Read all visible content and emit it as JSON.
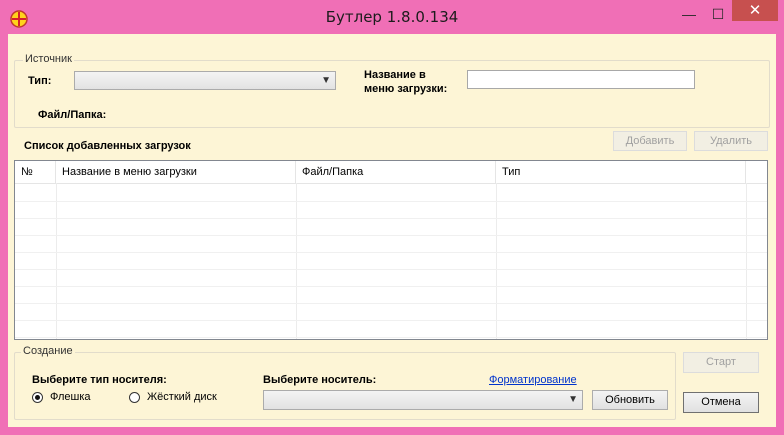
{
  "window": {
    "title": "Бутлер 1.8.0.134",
    "minimize_glyph": "—",
    "maximize_glyph": "☐",
    "close_glyph": "✕",
    "icon": "app-cross-icon"
  },
  "source": {
    "group_label": "Источник",
    "type_label": "Тип:",
    "type_value": "",
    "menu_name_label_line1": "Название в",
    "menu_name_label_line2": "меню загрузки:",
    "menu_name_value": "",
    "file_folder_label": "Файл/Папка:"
  },
  "downloads": {
    "heading": "Список добавленных загрузок",
    "add_label": "Добавить",
    "remove_label": "Удалить",
    "columns": [
      "№",
      "Название в меню загрузки",
      "Файл/Папка",
      "Тип"
    ],
    "rows": []
  },
  "creation": {
    "group_label": "Создание",
    "media_type_label": "Выберите тип носителя:",
    "flash_label": "Флешка",
    "hdd_label": "Жёсткий диск",
    "selected_media_type": "Флешка",
    "media_label": "Выберите носитель:",
    "format_link": "Форматирование",
    "media_value": "",
    "refresh_label": "Обновить"
  },
  "actions": {
    "start_label": "Старт",
    "cancel_label": "Отмена"
  },
  "colors": {
    "frame": "#f06fb6",
    "client": "#fdf5d6",
    "close": "#c7504f",
    "link": "#0033cc"
  }
}
